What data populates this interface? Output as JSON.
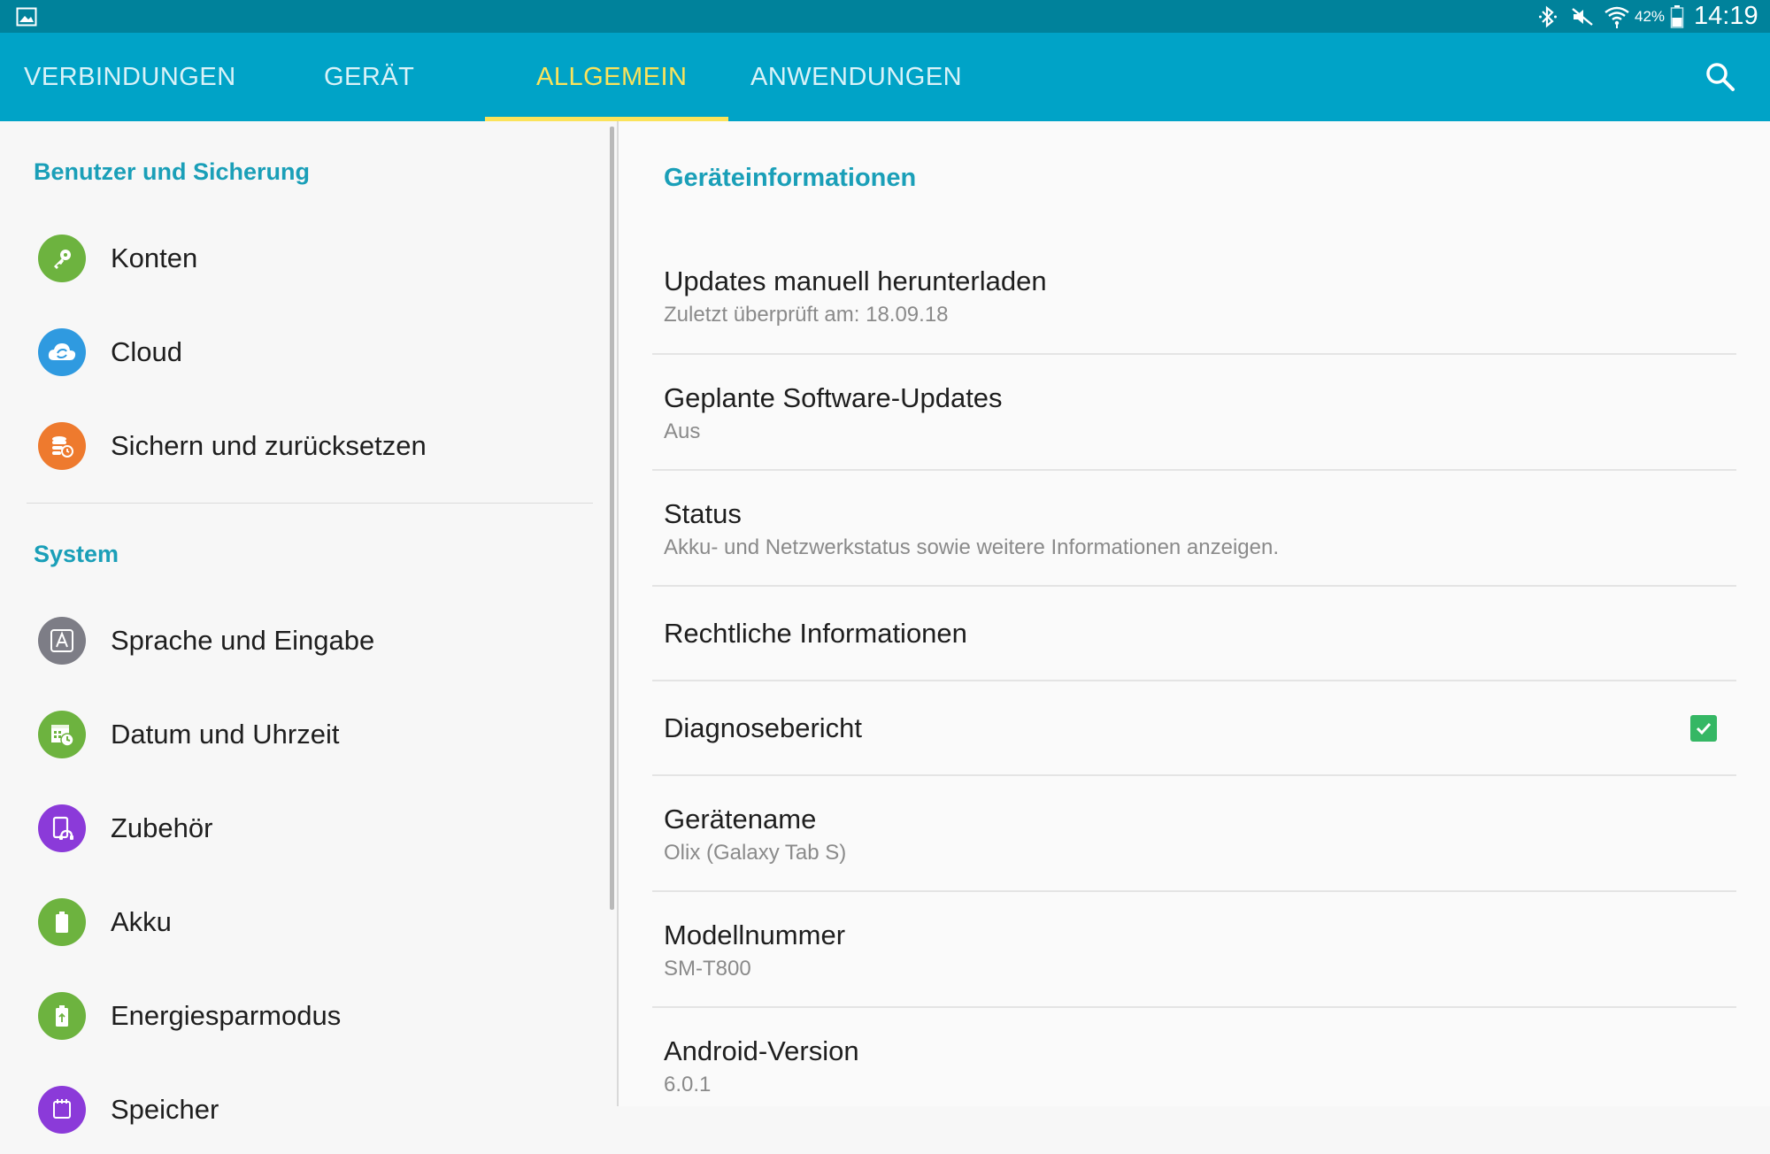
{
  "status_bar": {
    "battery_percent": "42%",
    "time": "14:19",
    "icons": [
      "gallery-icon",
      "bluetooth-icon",
      "mute-icon",
      "wifi-icon",
      "battery-icon"
    ]
  },
  "tabs": [
    {
      "label": "VERBINDUNGEN",
      "active": false
    },
    {
      "label": "GERÄT",
      "active": false
    },
    {
      "label": "ALLGEMEIN",
      "active": true
    },
    {
      "label": "ANWENDUNGEN",
      "active": false
    }
  ],
  "left_panel": {
    "sections": [
      {
        "title": "Benutzer und Sicherung",
        "items": [
          {
            "label": "Konten",
            "icon": "key-icon",
            "color": "#6db33f"
          },
          {
            "label": "Cloud",
            "icon": "cloud-sync-icon",
            "color": "#2f9ae0"
          },
          {
            "label": "Sichern und zurücksetzen",
            "icon": "backup-icon",
            "color": "#ee7a2e"
          }
        ]
      },
      {
        "title": "System",
        "items": [
          {
            "label": "Sprache und Eingabe",
            "icon": "language-icon",
            "color": "#7d7d86"
          },
          {
            "label": "Datum und Uhrzeit",
            "icon": "calendar-clock-icon",
            "color": "#6db33f"
          },
          {
            "label": "Zubehör",
            "icon": "accessory-icon",
            "color": "#8b3ad9"
          },
          {
            "label": "Akku",
            "icon": "battery-icon",
            "color": "#6db33f"
          },
          {
            "label": "Energiesparmodus",
            "icon": "power-saving-icon",
            "color": "#6db33f"
          },
          {
            "label": "Speicher",
            "icon": "storage-icon",
            "color": "#8b3ad9"
          }
        ]
      }
    ]
  },
  "right_panel": {
    "title": "Geräteinformationen",
    "items": [
      {
        "primary": "Updates manuell herunterladen",
        "secondary": "Zuletzt überprüft am: 18.09.18"
      },
      {
        "primary": "Geplante Software-Updates",
        "secondary": "Aus"
      },
      {
        "primary": "Status",
        "secondary": "Akku- und Netzwerkstatus sowie weitere Informationen anzeigen."
      },
      {
        "primary": "Rechtliche Informationen"
      },
      {
        "primary": "Diagnosebericht",
        "checked": true
      },
      {
        "primary": "Gerätename",
        "secondary": "Olix (Galaxy Tab S)"
      },
      {
        "primary": "Modellnummer",
        "secondary": "SM-T800"
      },
      {
        "primary": "Android-Version",
        "secondary": "6.0.1"
      }
    ]
  },
  "colors": {
    "status_bar": "#00829b",
    "tab_bar": "#00a3c7",
    "active_tab": "#fbe35a",
    "section_title": "#1a9fb8",
    "checkbox": "#35b764"
  }
}
